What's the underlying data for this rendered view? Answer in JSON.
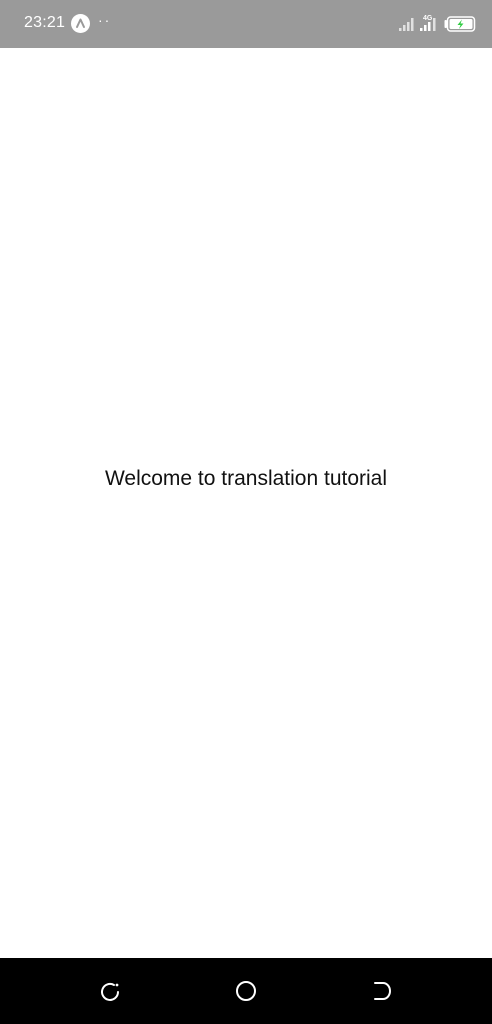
{
  "status_bar": {
    "time": "23:21",
    "more_indicator": "··",
    "network_label": "4G",
    "icons": [
      "app-notification-icon",
      "signal-icon",
      "battery-charging-icon"
    ],
    "colors": {
      "background": "#9a9a9a",
      "battery_bolt": "#2ecc40"
    }
  },
  "main": {
    "welcome_text": "Welcome to translation tutorial"
  },
  "nav_bar": {
    "buttons": [
      "recent-apps-icon",
      "home-icon",
      "back-icon"
    ],
    "color": "#000000"
  }
}
